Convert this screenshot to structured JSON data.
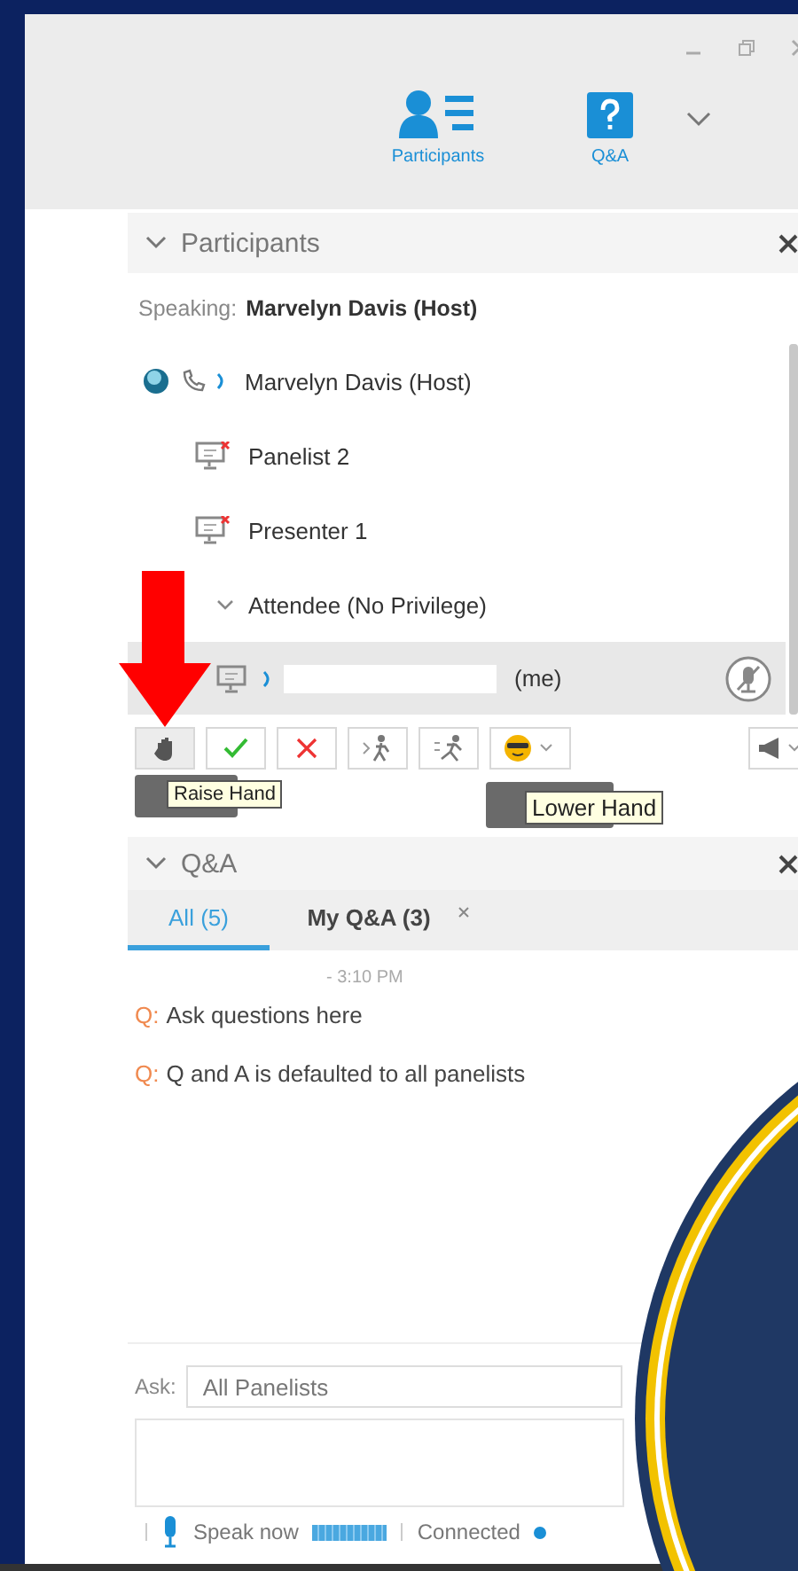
{
  "toolbar": [
    {
      "kind": "participants",
      "label": "Participants"
    },
    {
      "kind": "qa",
      "label": "Q&A"
    }
  ],
  "participants_panel": {
    "title": "Participants",
    "speaking_label": "Speaking:",
    "speaking_name": "Marvelyn Davis (Host)",
    "rows": [
      {
        "kind": "host",
        "name": "Marvelyn Davis (Host)",
        "selected": false
      },
      {
        "kind": "panelist",
        "name": "Panelist 2",
        "selected": false
      },
      {
        "kind": "panelist",
        "name": "Presenter 1",
        "selected": false
      },
      {
        "kind": "group",
        "name": "Attendee (No Privilege)",
        "selected": false
      },
      {
        "kind": "me",
        "name": "(me)",
        "selected": true
      }
    ],
    "reaction_buttons": [
      {
        "kind": "hand"
      },
      {
        "kind": "check"
      },
      {
        "kind": "cross"
      },
      {
        "kind": "slow"
      },
      {
        "kind": "fast"
      },
      {
        "kind": "emoji"
      }
    ],
    "tooltips": [
      "Raise Hand",
      "Lower Hand"
    ]
  },
  "qa_panel": {
    "title": "Q&A",
    "tabs": [
      {
        "label": "All (5)",
        "selected": true
      },
      {
        "label": "My Q&A (3)",
        "selected": false
      }
    ],
    "time": "- 3:10 PM",
    "questions": [
      {
        "prefix": "Q:",
        "text": "Ask questions here"
      },
      {
        "prefix": "Q:",
        "text": "Q and A is defaulted to all panelists"
      }
    ],
    "ask_label": "Ask:",
    "ask_value": "All Panelists"
  },
  "status_bar": {
    "speak_label": "Speak now",
    "level": 1,
    "connection": "Connected"
  }
}
